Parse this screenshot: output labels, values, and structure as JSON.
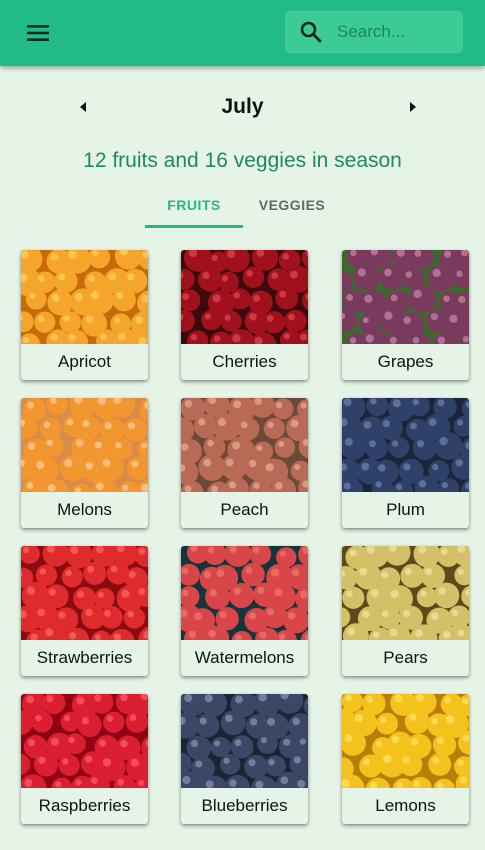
{
  "appbar": {
    "menu_icon": "hamburger-menu-icon",
    "search_icon": "search-icon",
    "search_placeholder": "Search...",
    "color": "#21bb87"
  },
  "month_nav": {
    "month": "July",
    "prev_icon": "chevron-left-icon",
    "next_icon": "chevron-right-icon"
  },
  "season_summary": "12 fruits and 16 veggies in season",
  "tabs": [
    {
      "label": "FRUITS",
      "active": true
    },
    {
      "label": "VEGGIES",
      "active": false
    }
  ],
  "produce": [
    {
      "name": "Apricot",
      "bg": "#c8690a",
      "fruit": "#f5a52a",
      "hi": "#ffd36a"
    },
    {
      "name": "Cherries",
      "bg": "#3a0a0d",
      "fruit": "#a0111d",
      "hi": "#e24a4c"
    },
    {
      "name": "Grapes",
      "bg": "#3c6a2c",
      "fruit": "#7a3a5e",
      "hi": "#c68aa8"
    },
    {
      "name": "Melons",
      "bg": "#d98c4a",
      "fruit": "#f2962f",
      "hi": "#ffd0a0"
    },
    {
      "name": "Peach",
      "bg": "#6b4a3a",
      "fruit": "#b86a56",
      "hi": "#e8b08e"
    },
    {
      "name": "Plum",
      "bg": "#1a2638",
      "fruit": "#2f4168",
      "hi": "#6f83ab"
    },
    {
      "name": "Strawberries",
      "bg": "#8a0c10",
      "fruit": "#df2a2e",
      "hi": "#ff6b5c"
    },
    {
      "name": "Watermelons",
      "bg": "#14363a",
      "fruit": "#d8464a",
      "hi": "#f07a6a"
    },
    {
      "name": "Pears",
      "bg": "#5a4a1e",
      "fruit": "#d4c066",
      "hi": "#f2e6a6"
    },
    {
      "name": "Raspberries",
      "bg": "#8e0414",
      "fruit": "#dc1e32",
      "hi": "#ff5f6e"
    },
    {
      "name": "Blueberries",
      "bg": "#1c2333",
      "fruit": "#3a4866",
      "hi": "#8b96b6"
    },
    {
      "name": "Lemons",
      "bg": "#b87e08",
      "fruit": "#f4c21c",
      "hi": "#ffe86a"
    }
  ]
}
